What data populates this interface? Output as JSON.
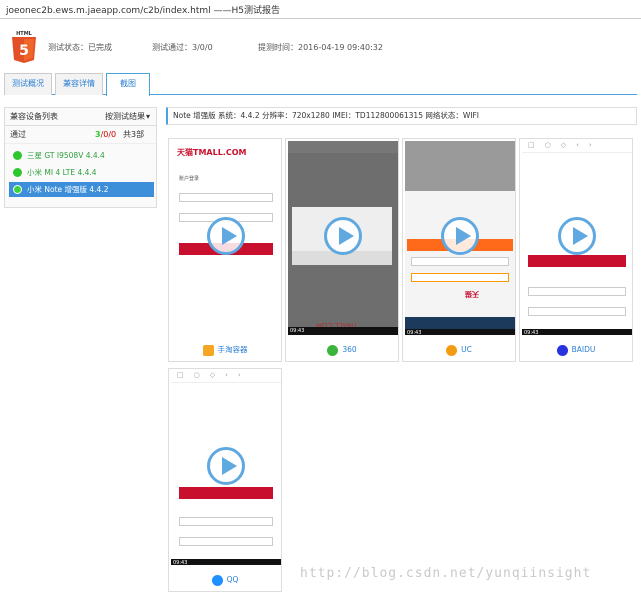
{
  "url_title": "joeonec2b.ews.m.jaeapp.com/c2b/index.html ——H5测试报告",
  "header": {
    "logo_text": "HTML",
    "status": "测试状态：已完成",
    "pass": "测试通过：3/0/0",
    "time": "提测时间：2016-04-19 09:40:32"
  },
  "tabs": [
    "测试概况",
    "兼容详情",
    "截图"
  ],
  "sidebar": {
    "title": "兼容设备列表",
    "filter": "按测试结果",
    "summary_label": "通过",
    "summary_pass": "3",
    "summary_rest": "/0/0",
    "summary_total": "共3部",
    "devices": [
      "三星 GT I9508V 4.4.4",
      "小米 MI 4 LTE 4.4.4",
      "小米 Note 增强版 4.4.2"
    ]
  },
  "info": "Note 增强版    系统：4.4.2    分辨率：720x1280    IMEI：TD112800061315    网络状态：WIFI",
  "browsers": [
    "手淘容器",
    "360",
    "UC",
    "BAIDU",
    "QQ"
  ],
  "screen_text": {
    "tmall": "天猫TMALL.COM",
    "login": "账户登录",
    "status_time": "09:43"
  },
  "watermark": "http://blog.csdn.net/yunqiinsight",
  "colors": {
    "accent": "#4aa3df",
    "pass": "#2ec62e",
    "brand_red": "#c8102e"
  }
}
